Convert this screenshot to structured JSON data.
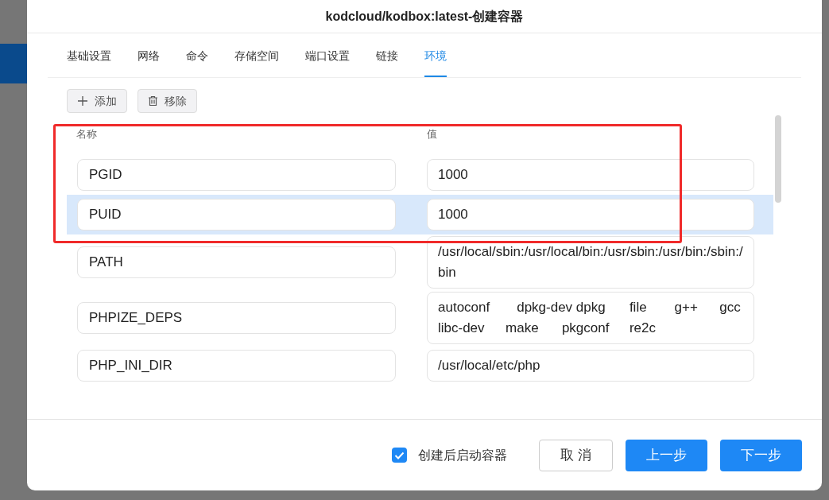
{
  "dialog": {
    "title": "kodcloud/kodbox:latest-创建容器"
  },
  "tabs": [
    {
      "label": "基础设置",
      "selected": false
    },
    {
      "label": "网络",
      "selected": false
    },
    {
      "label": "命令",
      "selected": false
    },
    {
      "label": "存储空间",
      "selected": false
    },
    {
      "label": "端口设置",
      "selected": false
    },
    {
      "label": "链接",
      "selected": false
    },
    {
      "label": "环境",
      "selected": true
    }
  ],
  "toolbar": [
    {
      "kind": "add",
      "label": "添加"
    },
    {
      "kind": "remove",
      "label": "移除"
    }
  ],
  "table": {
    "columns": [
      "名称",
      "值"
    ],
    "rows": [
      {
        "name": "PGID",
        "value": "1000",
        "selected": false
      },
      {
        "name": "PUID",
        "value": "1000",
        "selected": true
      },
      {
        "name": "PATH",
        "value": "/usr/local/sbin:/usr/local/bin:/usr/sbin:/usr/bin:/sbin:/bin",
        "selected": false
      },
      {
        "name": "PHPIZE_DEPS",
        "value": "autoconf \t\tdpkg-dev dpkg \t\tfile \t\tg++ \t\tgcc \t\tlibc-dev \t\tmake \t\tpkgconf \t\tre2c",
        "selected": false
      },
      {
        "name": "PHP_INI_DIR",
        "value": "/usr/local/etc/php",
        "selected": false
      }
    ]
  },
  "footer": {
    "start_after_create": {
      "label": "创建后启动容器",
      "checked": true
    },
    "buttons": [
      {
        "kind": "default",
        "label": "取 消"
      },
      {
        "kind": "primary",
        "label": "上一步"
      },
      {
        "kind": "primary",
        "label": "下一步"
      }
    ]
  }
}
